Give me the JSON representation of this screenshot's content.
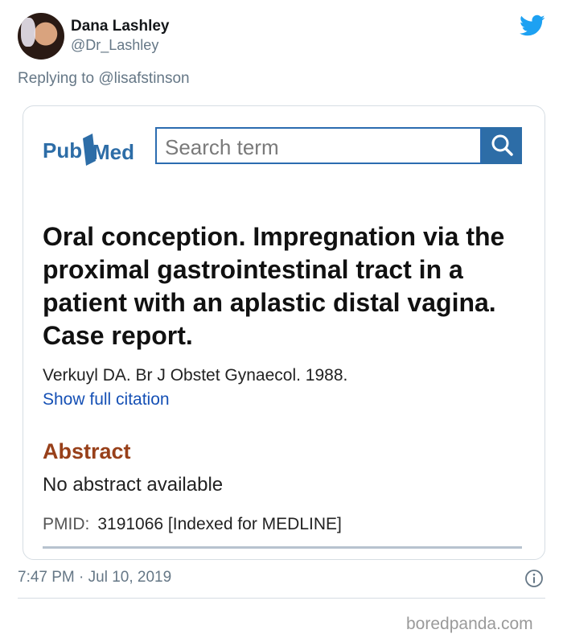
{
  "tweet": {
    "author_name": "Dana Lashley",
    "author_handle": "@Dr_Lashley",
    "reply_prefix": "Replying to",
    "reply_to": "@lisafstinson",
    "timestamp": "7:47 PM · Jul 10, 2019"
  },
  "card": {
    "logo": {
      "part1": "Pub",
      "part2": "Med"
    },
    "search_placeholder": "Search term",
    "title": "Oral conception. Impregnation via the proximal gastrointestinal tract in a patient with an aplastic distal vagina. Case report.",
    "authors": "Verkuyl DA. Br J Obstet Gynaecol. 1988.",
    "show_citation": "Show full citation",
    "abstract_heading": "Abstract",
    "abstract_text": "No abstract available",
    "pmid_label": "PMID:",
    "pmid_value": "3191066 [Indexed for MEDLINE]"
  },
  "icons": {
    "brand": "twitter-bird-icon",
    "search": "magnifier-icon",
    "info": "info-circle-icon"
  },
  "colors": {
    "twitter_blue": "#1da1f2",
    "pubmed_blue": "#2d6da7",
    "abstract_brown": "#98401a",
    "link_blue": "#1550b5"
  },
  "watermark": "boredpanda.com"
}
